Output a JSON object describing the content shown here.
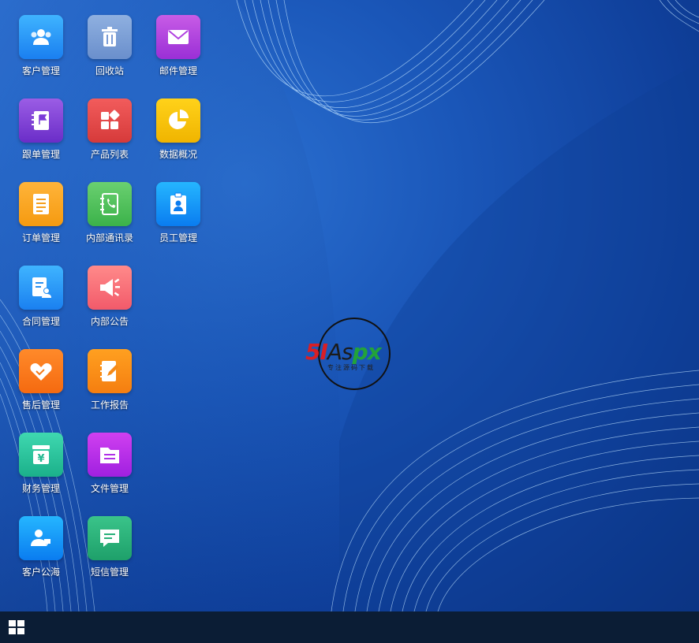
{
  "desktop": {
    "icons": [
      {
        "label": "客户管理",
        "icon": "users-icon",
        "color_top": "#3fb4ff",
        "color_bottom": "#1a7ff0"
      },
      {
        "label": "回收站",
        "icon": "trash-icon",
        "color_top": "#8fb0e0",
        "color_bottom": "#6a8fcc"
      },
      {
        "label": "邮件管理",
        "icon": "mail-icon",
        "color_top": "#c85ce6",
        "color_bottom": "#9a2fd6"
      },
      {
        "label": "跟单管理",
        "icon": "notebook-flag-icon",
        "color_top": "#9b5de5",
        "color_bottom": "#6a2dc8"
      },
      {
        "label": "产品列表",
        "icon": "shapes-icon",
        "color_top": "#f25c5c",
        "color_bottom": "#d63a3a"
      },
      {
        "label": "数据概况",
        "icon": "pie-chart-icon",
        "color_top": "#ffd21a",
        "color_bottom": "#f0b400"
      },
      {
        "label": "订单管理",
        "icon": "document-icon",
        "color_top": "#ffb43a",
        "color_bottom": "#f59a10"
      },
      {
        "label": "内部通讯录",
        "icon": "phone-book-icon",
        "color_top": "#6ad070",
        "color_bottom": "#3bb24a"
      },
      {
        "label": "员工管理",
        "icon": "id-badge-icon",
        "color_top": "#25b6ff",
        "color_bottom": "#0a7cf0"
      },
      {
        "label": "合同管理",
        "icon": "contract-icon",
        "color_top": "#3fb4ff",
        "color_bottom": "#1a80f0"
      },
      {
        "label": "内部公告",
        "icon": "megaphone-icon",
        "color_top": "#ff8a8a",
        "color_bottom": "#f25a6a"
      },
      {
        "label": "售后管理",
        "icon": "handshake-icon",
        "color_top": "#ff8a2a",
        "color_bottom": "#f56a10"
      },
      {
        "label": "工作报告",
        "icon": "report-pen-icon",
        "color_top": "#ffa020",
        "color_bottom": "#f57e10"
      },
      {
        "label": "财务管理",
        "icon": "finance-icon",
        "color_top": "#3fd8b0",
        "color_bottom": "#1bb08a"
      },
      {
        "label": "文件管理",
        "icon": "folder-icon",
        "color_top": "#d040f0",
        "color_bottom": "#a020e0"
      },
      {
        "label": "客户公海",
        "icon": "customer-pool-icon",
        "color_top": "#25b6ff",
        "color_bottom": "#0a7cf0"
      },
      {
        "label": "短信管理",
        "icon": "message-icon",
        "color_top": "#3ac48a",
        "color_bottom": "#1ea06a"
      }
    ]
  },
  "logo": {
    "text_red": "5I",
    "text_dark": "As",
    "text_green": "px",
    "subtitle": "专注源码下载"
  },
  "taskbar": {
    "start_icon": "windows-icon"
  }
}
